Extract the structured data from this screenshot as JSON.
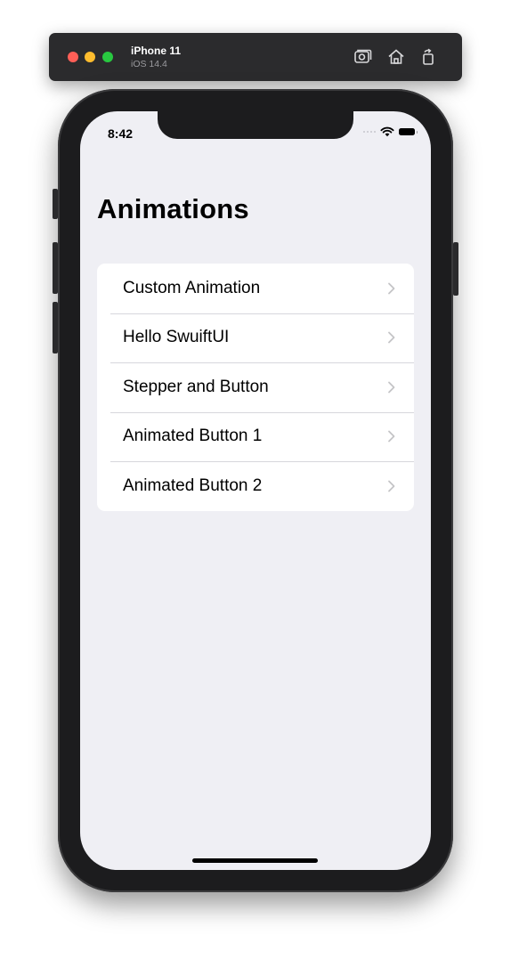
{
  "simulator": {
    "device": "iPhone 11",
    "os": "iOS 14.4",
    "toolbar_icons": [
      "screenshot-icon",
      "home-icon",
      "rotate-icon"
    ]
  },
  "status_bar": {
    "time": "8:42",
    "icons": [
      "cellular-signal-icon",
      "wifi-icon",
      "battery-icon"
    ]
  },
  "nav": {
    "title": "Animations"
  },
  "list": {
    "items": [
      {
        "label": "Custom Animation"
      },
      {
        "label": "Hello SwuiftUI"
      },
      {
        "label": "Stepper and Button"
      },
      {
        "label": "Animated Button 1"
      },
      {
        "label": "Animated Button 2"
      }
    ]
  },
  "colors": {
    "background": "#efeff4",
    "cell": "#ffffff",
    "separator": "#d7d7dc",
    "chevron": "#c4c4c7",
    "traffic_red": "#ff5f57",
    "traffic_yellow": "#febc2e",
    "traffic_green": "#28c840"
  }
}
